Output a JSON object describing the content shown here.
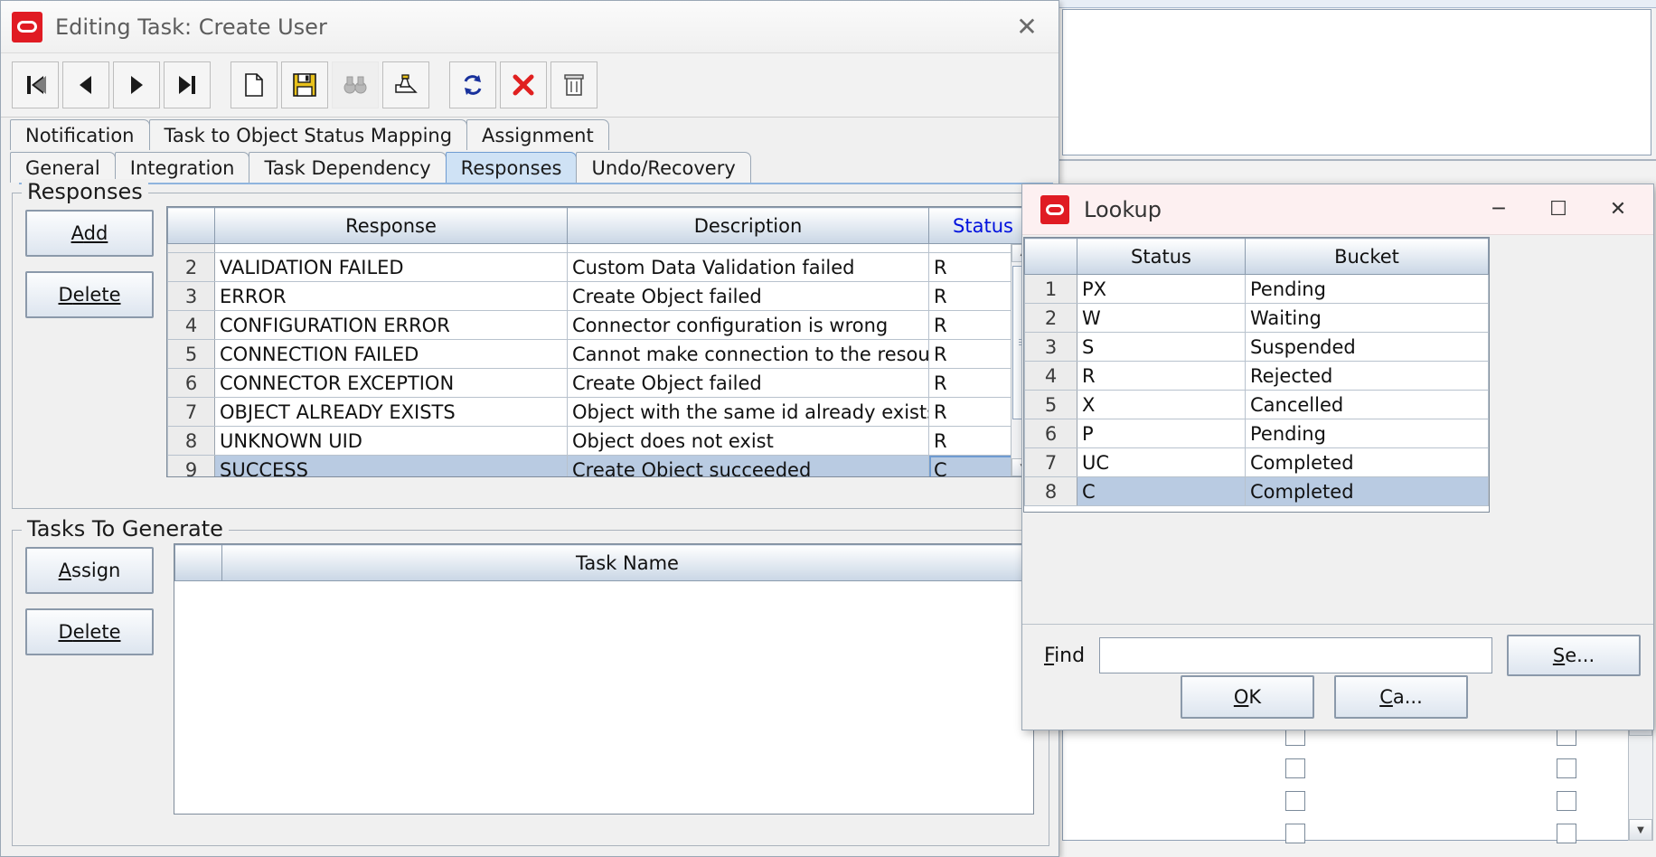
{
  "background_app": {
    "name": "design-console-background"
  },
  "task_dialog": {
    "title": "Editing Task: Create User",
    "close_label": "✕",
    "toolbar": [
      {
        "name": "first-record-button",
        "icon": "first-record-icon"
      },
      {
        "name": "previous-record-button",
        "icon": "previous-record-icon"
      },
      {
        "name": "next-record-button",
        "icon": "next-record-icon"
      },
      {
        "name": "last-record-button",
        "icon": "last-record-icon"
      },
      {
        "name": "new-button",
        "icon": "new-document-icon"
      },
      {
        "name": "save-button",
        "icon": "floppy-save-icon"
      },
      {
        "name": "find-button",
        "icon": "binoculars-icon"
      },
      {
        "name": "report-button",
        "icon": "report-icon"
      },
      {
        "name": "refresh-button",
        "icon": "refresh-icon"
      },
      {
        "name": "delete-button",
        "icon": "red-x-icon"
      },
      {
        "name": "trash-button",
        "icon": "trash-icon"
      }
    ],
    "tabs_row1": [
      {
        "label": "Notification",
        "active": false
      },
      {
        "label": "Task to Object Status Mapping",
        "active": false
      },
      {
        "label": "Assignment",
        "active": false
      }
    ],
    "tabs_row2": [
      {
        "label": "General",
        "active": false
      },
      {
        "label": "Integration",
        "active": false
      },
      {
        "label": "Task Dependency",
        "active": false
      },
      {
        "label": "Responses",
        "active": true
      },
      {
        "label": "Undo/Recovery",
        "active": false
      }
    ],
    "responses": {
      "group_title": "Responses",
      "add_label": "Add",
      "delete_label": "Delete",
      "columns": [
        "",
        "Response",
        "Description",
        "Status"
      ],
      "sorted_column": "Status",
      "rows": [
        {
          "num": "",
          "response": "",
          "description": "",
          "status": "",
          "partial": true
        },
        {
          "num": "2",
          "response": "VALIDATION  FAILED",
          "description": "Custom Data Validation failed",
          "status": "R"
        },
        {
          "num": "3",
          "response": "ERROR",
          "description": "Create Object failed",
          "status": "R"
        },
        {
          "num": "4",
          "response": "CONFIGURATION  ERROR",
          "description": "Connector configuration is wrong",
          "status": "R"
        },
        {
          "num": "5",
          "response": "CONNECTION  FAILED",
          "description": "Cannot make connection to the resource",
          "status": "R"
        },
        {
          "num": "6",
          "response": "CONNECTOR  EXCEPTION",
          "description": "Create Object failed",
          "status": "R"
        },
        {
          "num": "7",
          "response": "OBJECT  ALREADY  EXISTS",
          "description": "Object with the same id already exists",
          "status": "R"
        },
        {
          "num": "8",
          "response": "UNKNOWN  UID",
          "description": "Object does not exist",
          "status": "R"
        },
        {
          "num": "9",
          "response": "SUCCESS",
          "description": "Create Object succeeded",
          "status": "C",
          "selected": true
        }
      ]
    },
    "tasks_to_generate": {
      "group_title": "Tasks To Generate",
      "assign_label": "Assign",
      "delete_label": "Delete",
      "columns": [
        "",
        "Task Name"
      ],
      "rows": []
    }
  },
  "lookup_dialog": {
    "title": "Lookup",
    "minimize_label": "─",
    "maximize_label": "☐",
    "close_label": "✕",
    "columns": [
      "",
      "Status",
      "Bucket"
    ],
    "rows": [
      {
        "num": "1",
        "status": "PX",
        "bucket": "Pending"
      },
      {
        "num": "2",
        "status": "W",
        "bucket": "Waiting"
      },
      {
        "num": "3",
        "status": "S",
        "bucket": "Suspended"
      },
      {
        "num": "4",
        "status": "R",
        "bucket": "Rejected"
      },
      {
        "num": "5",
        "status": "X",
        "bucket": "Cancelled"
      },
      {
        "num": "6",
        "status": "P",
        "bucket": "Pending"
      },
      {
        "num": "7",
        "status": "UC",
        "bucket": "Completed"
      },
      {
        "num": "8",
        "status": "C",
        "bucket": "Completed",
        "selected": true
      }
    ],
    "find_label": "Find",
    "find_value": "",
    "search_label": "Se...",
    "ok_label": "OK",
    "cancel_label": "Ca..."
  },
  "colors": {
    "oracle_red": "#e01b23",
    "active_tab": "#cfe2f5",
    "selection": "#b9cbe2",
    "sorted_header_text": "#0011dd",
    "lookup_titlebar": "#fdf0f1"
  }
}
